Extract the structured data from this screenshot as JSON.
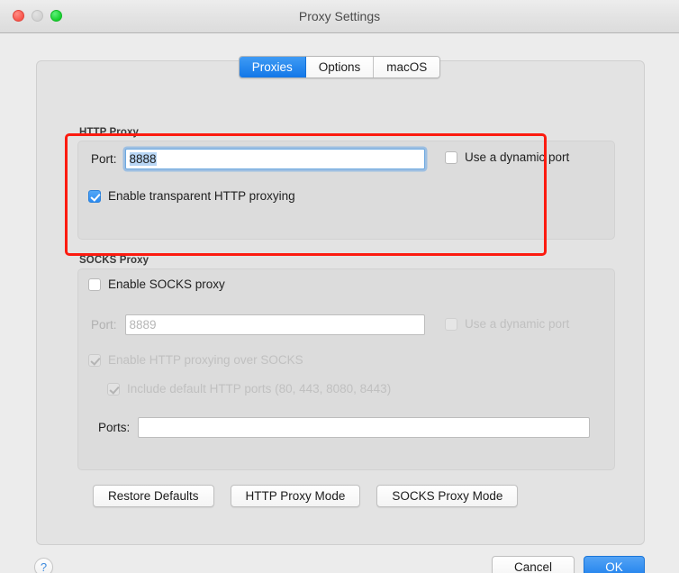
{
  "window": {
    "title": "Proxy Settings",
    "traffic_lights": [
      {
        "name": "close",
        "color": "#f8564c"
      },
      {
        "name": "minimize",
        "color": "#d2d2d2"
      },
      {
        "name": "zoom",
        "color": "#16cf2e"
      }
    ]
  },
  "tabs": [
    {
      "label": "Proxies",
      "active": true
    },
    {
      "label": "Options",
      "active": false
    },
    {
      "label": "macOS",
      "active": false
    }
  ],
  "http_proxy": {
    "group_label": "HTTP Proxy",
    "port_label": "Port:",
    "port_value": "8888",
    "dynamic_port_label": "Use a dynamic port",
    "dynamic_port_checked": false,
    "transparent_label": "Enable transparent HTTP proxying",
    "transparent_checked": true
  },
  "socks_proxy": {
    "group_label": "SOCKS Proxy",
    "enable_label": "Enable SOCKS proxy",
    "enable_checked": false,
    "port_label": "Port:",
    "port_placeholder": "8889",
    "dynamic_port_label": "Use a dynamic port",
    "dynamic_port_checked": false,
    "http_over_socks_label": "Enable HTTP proxying over SOCKS",
    "http_over_socks_checked": true,
    "default_ports_label": "Include default HTTP ports (80, 443, 8080, 8443)",
    "default_ports_checked": true,
    "ports_label": "Ports:",
    "ports_value": ""
  },
  "mode_buttons": [
    {
      "label": "Restore Defaults"
    },
    {
      "label": "HTTP Proxy Mode"
    },
    {
      "label": "SOCKS Proxy Mode"
    }
  ],
  "footer": {
    "help_label": "?",
    "cancel_label": "Cancel",
    "ok_label": "OK"
  },
  "annotation": {
    "color": "#fc1b10",
    "target": "HTTP Proxy"
  }
}
